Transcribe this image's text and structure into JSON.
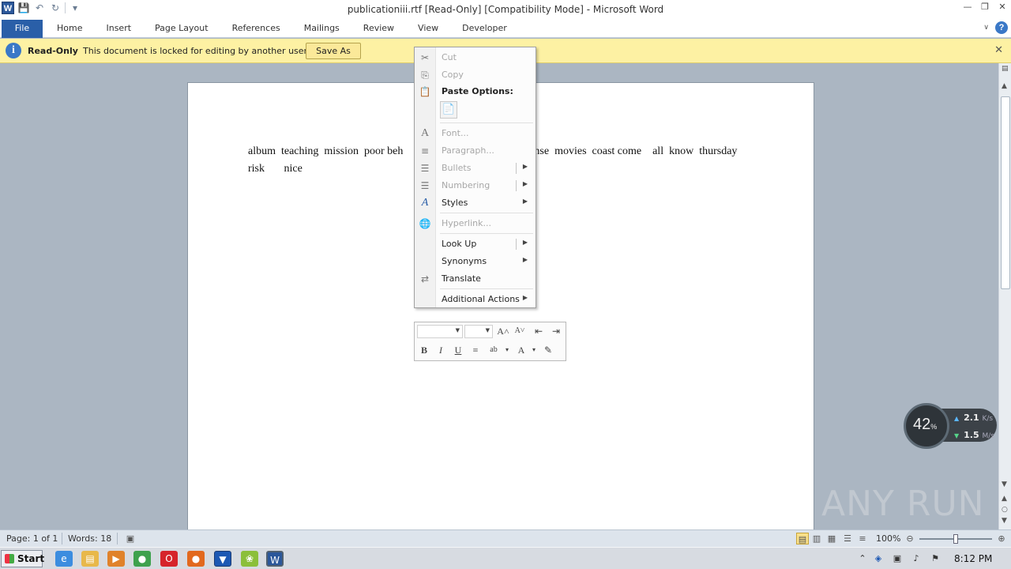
{
  "titlebar": {
    "title": "publicationiii.rtf [Read-Only] [Compatibility Mode]  -  Microsoft Word",
    "logo_letter": "W"
  },
  "ribbon": {
    "file_tab": "File",
    "tabs": [
      "Home",
      "Insert",
      "Page Layout",
      "References",
      "Mailings",
      "Review",
      "View",
      "Developer"
    ]
  },
  "message_bar": {
    "title": "Read-Only",
    "text": "This document is locked for editing by another user.",
    "button": "Save As"
  },
  "document": {
    "text": "album  teaching  mission  poor beh                                     not  sense  movies  coast come    all  know  thursday  risk       nice"
  },
  "context_menu": {
    "items": [
      {
        "label": "Cut",
        "disabled": true,
        "icon": "scissors-icon"
      },
      {
        "label": "Copy",
        "disabled": true,
        "icon": "copy-icon"
      },
      {
        "label": "Paste Options:",
        "disabled": false,
        "icon": "paste-icon"
      },
      {
        "label": "Font...",
        "disabled": true,
        "icon": "font-icon"
      },
      {
        "label": "Paragraph...",
        "disabled": true,
        "icon": "paragraph-icon"
      },
      {
        "label": "Bullets",
        "disabled": true,
        "icon": "bullets-icon"
      },
      {
        "label": "Numbering",
        "disabled": true,
        "icon": "numbering-icon"
      },
      {
        "label": "Styles",
        "disabled": false,
        "icon": "styles-icon"
      },
      {
        "label": "Hyperlink...",
        "disabled": true,
        "icon": "hyperlink-icon"
      },
      {
        "label": "Look Up",
        "disabled": false,
        "icon": ""
      },
      {
        "label": "Synonyms",
        "disabled": false,
        "icon": ""
      },
      {
        "label": "Translate",
        "disabled": false,
        "icon": "translate-icon"
      },
      {
        "label": "Additional Actions",
        "disabled": false,
        "icon": ""
      }
    ]
  },
  "status_bar": {
    "page": "Page: 1 of 1",
    "words": "Words: 18",
    "zoom": "100%"
  },
  "taskbar": {
    "start": "Start",
    "time": "8:12 PM"
  },
  "net_widget": {
    "percent": "42",
    "percent_unit": "%",
    "up_value": "2.1",
    "up_unit": "K/s",
    "down_value": "1.5",
    "down_unit": "M/s"
  },
  "watermark": "ANY RUN"
}
